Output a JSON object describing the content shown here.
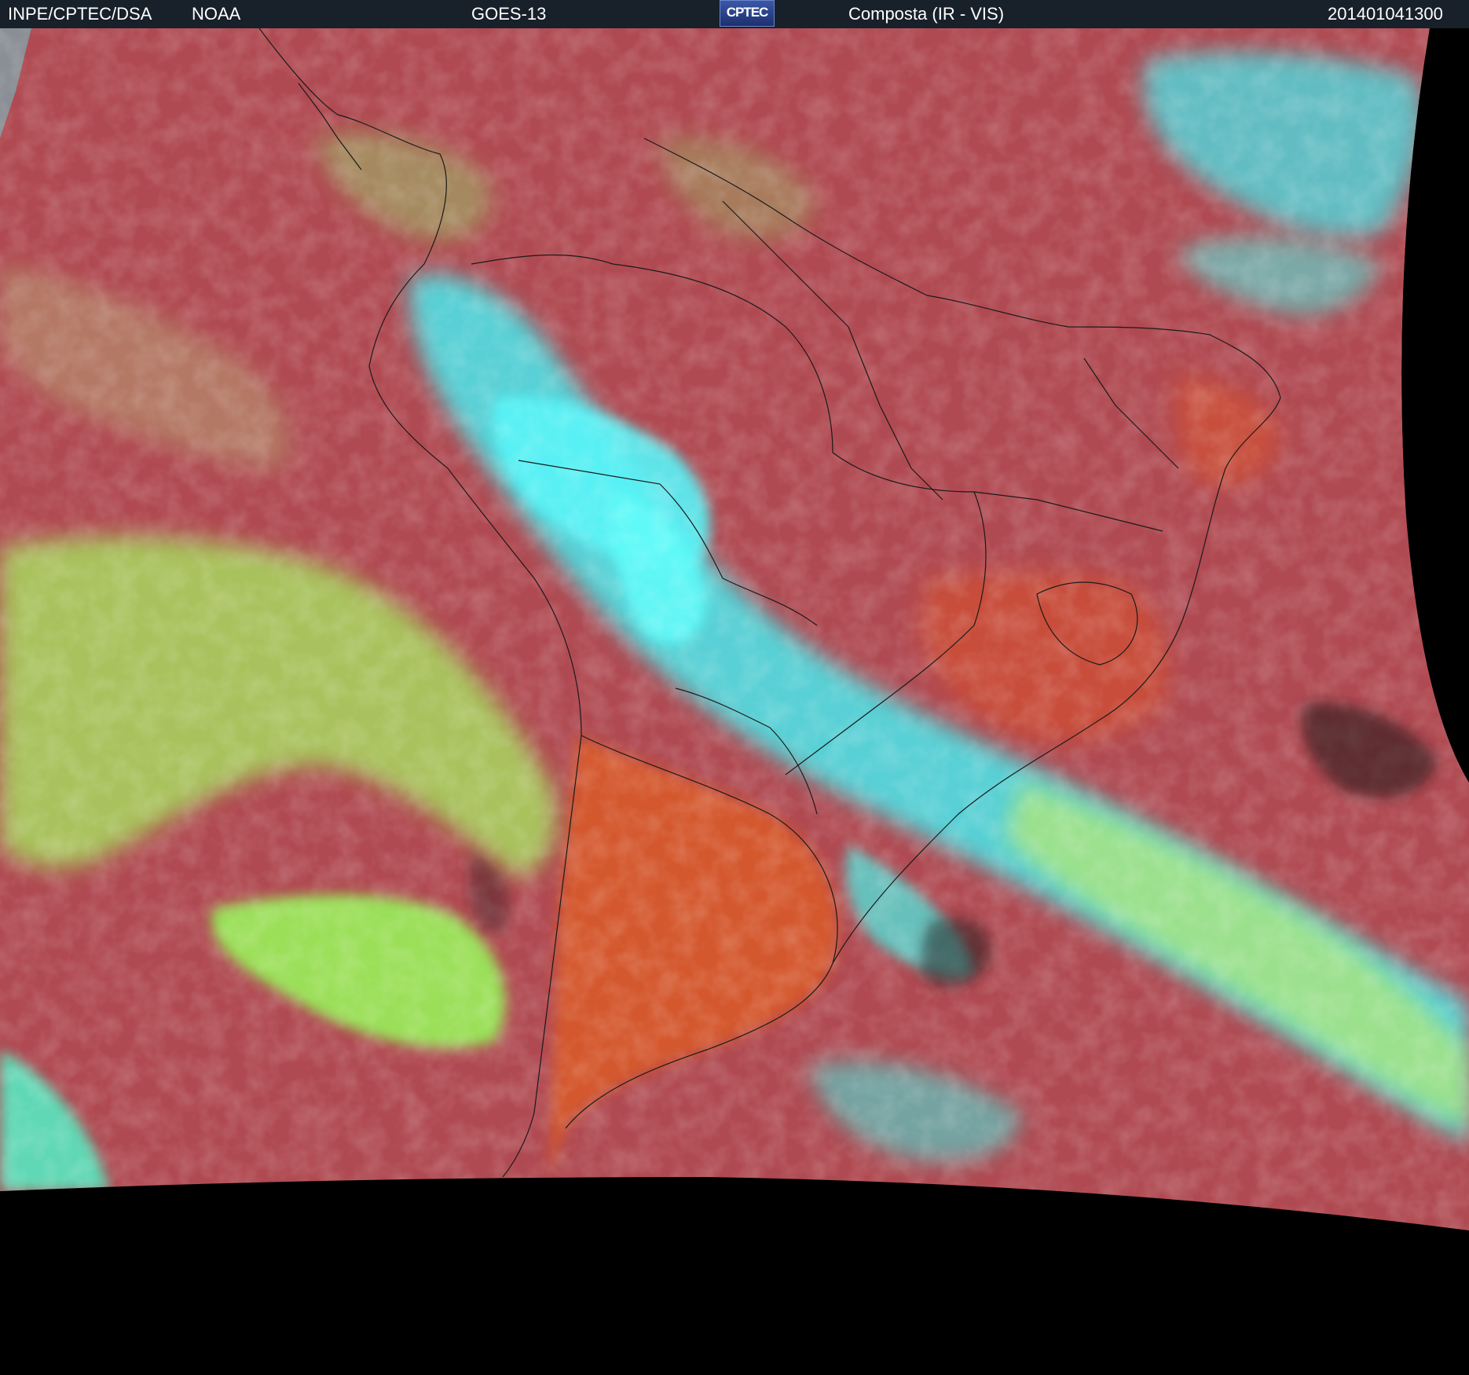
{
  "header": {
    "agency": "INPE/CPTEC/DSA",
    "source": "NOAA",
    "satellite": "GOES-13",
    "logo_text": "CPTEC",
    "product": "Composta (IR - VIS)",
    "timestamp": "201401041300"
  },
  "colors": {
    "header_bg": "#18202a",
    "ocean_land_clear": "#b04a52",
    "warm_land": "#d4582e",
    "high_cloud": "#48f0f0",
    "low_cloud": "#98e858",
    "space": "#000000",
    "borders": "#1a1a1a"
  }
}
